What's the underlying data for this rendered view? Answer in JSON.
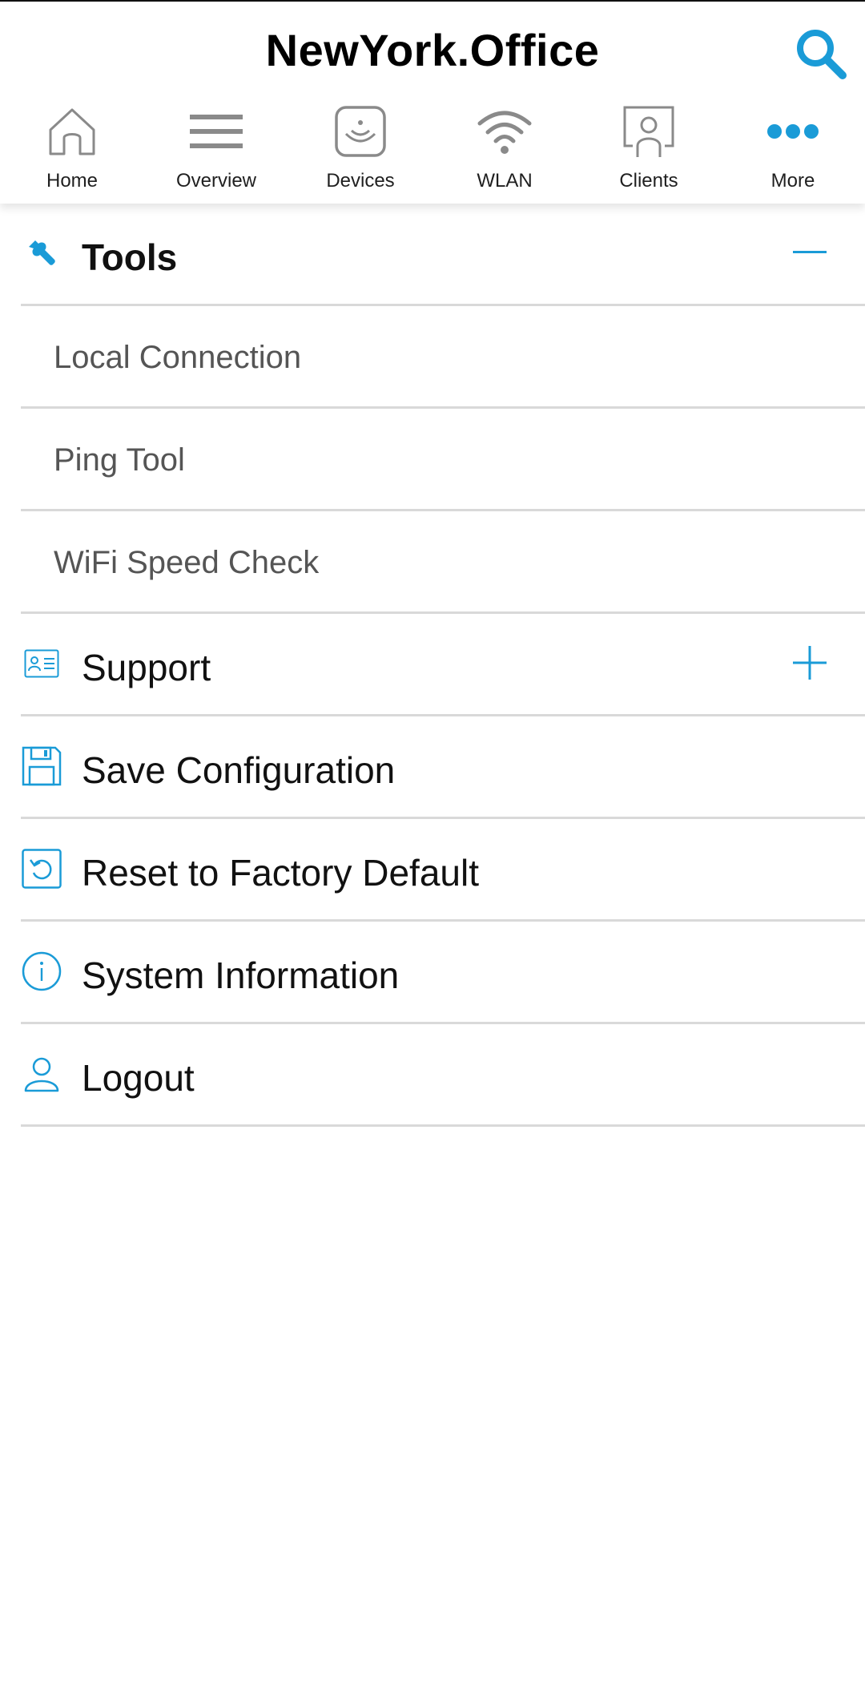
{
  "header": {
    "title": "NewYork.Office"
  },
  "tabs": [
    {
      "label": "Home",
      "icon": "home-icon"
    },
    {
      "label": "Overview",
      "icon": "menu-lines-icon"
    },
    {
      "label": "Devices",
      "icon": "access-point-icon"
    },
    {
      "label": "WLAN",
      "icon": "wifi-icon"
    },
    {
      "label": "Clients",
      "icon": "client-icon"
    },
    {
      "label": "More",
      "icon": "more-dots-icon"
    }
  ],
  "menu": {
    "tools": {
      "label": "Tools",
      "icon": "wrench-icon",
      "state": "expanded"
    },
    "tools_items": [
      {
        "label": "Local Connection"
      },
      {
        "label": "Ping Tool"
      },
      {
        "label": "WiFi Speed Check"
      }
    ],
    "support": {
      "label": "Support",
      "icon": "id-card-icon",
      "state": "collapsed"
    },
    "save": {
      "label": "Save Configuration",
      "icon": "floppy-disk-icon"
    },
    "reset": {
      "label": "Reset to Factory Default",
      "icon": "reset-icon"
    },
    "sysinfo": {
      "label": "System Information",
      "icon": "info-icon"
    },
    "logout": {
      "label": "Logout",
      "icon": "user-icon"
    }
  },
  "colors": {
    "accent": "#1a9bd7",
    "icon_gray": "#8a8a8a",
    "divider": "#d9d9d9"
  }
}
